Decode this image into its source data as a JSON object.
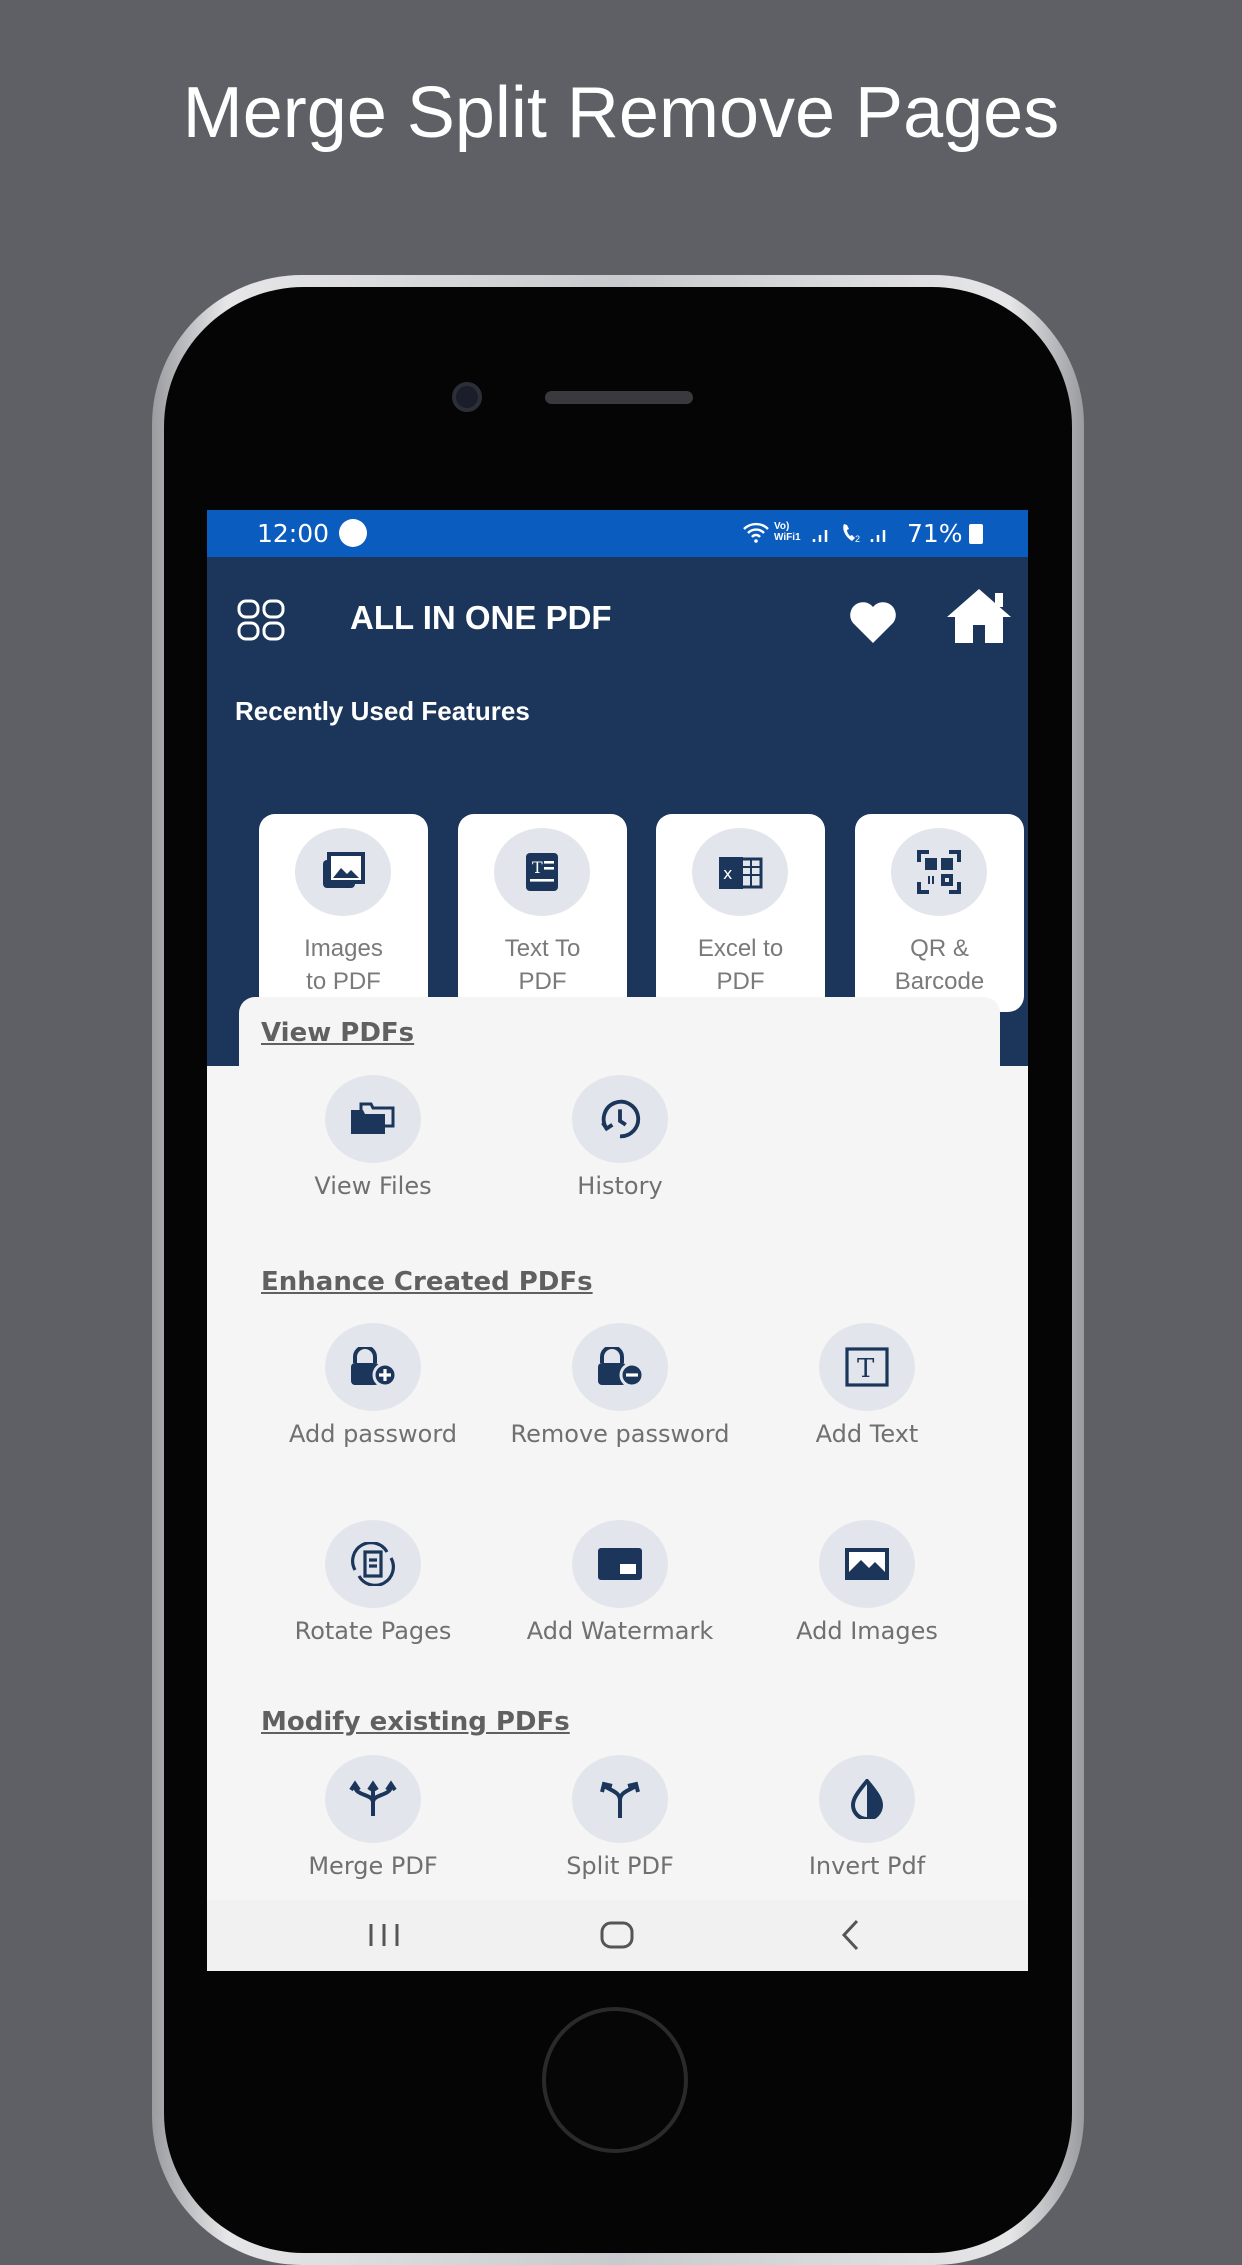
{
  "promo_title": "Merge Split Remove Pages",
  "status_bar": {
    "time": "12:00",
    "battery": "71%",
    "network_label": "Vo) WiFi1"
  },
  "app_bar": {
    "title": "ALL IN ONE PDF",
    "menu_icon": "grid-icon",
    "favorite_icon": "heart-icon",
    "home_icon": "home-icon"
  },
  "recent": {
    "heading": "Recently Used Features",
    "items": [
      {
        "line1": "Images",
        "line2": "to PDF",
        "icon": "images-icon"
      },
      {
        "line1": "Text To",
        "line2": "PDF",
        "icon": "text-doc-icon"
      },
      {
        "line1": "Excel to",
        "line2": "PDF",
        "icon": "excel-icon"
      },
      {
        "line1": "QR &",
        "line2": "Barcode",
        "icon": "qr-code-icon"
      }
    ]
  },
  "sections": [
    {
      "heading": "View PDFs",
      "items": [
        {
          "label": "View Files",
          "icon": "folders-icon"
        },
        {
          "label": "History",
          "icon": "history-icon"
        }
      ]
    },
    {
      "heading": "Enhance Created PDFs",
      "items": [
        {
          "label": "Add password",
          "icon": "lock-plus-icon"
        },
        {
          "label": "Remove password",
          "icon": "lock-minus-icon"
        },
        {
          "label": "Add Text",
          "icon": "text-box-icon"
        },
        {
          "label": "Rotate Pages",
          "icon": "rotate-icon"
        },
        {
          "label": "Add Watermark",
          "icon": "watermark-icon"
        },
        {
          "label": "Add Images",
          "icon": "image-icon"
        }
      ]
    },
    {
      "heading": "Modify existing PDFs",
      "items": [
        {
          "label": "Merge PDF",
          "icon": "merge-icon"
        },
        {
          "label": "Split PDF",
          "icon": "split-icon"
        },
        {
          "label": "Invert Pdf",
          "icon": "invert-icon"
        }
      ]
    }
  ],
  "colors": {
    "status_bar": "#0b5cbf",
    "app_bar": "#1b365a",
    "icon_bg": "#e2e6ec",
    "icon_fg": "#1b365a"
  }
}
